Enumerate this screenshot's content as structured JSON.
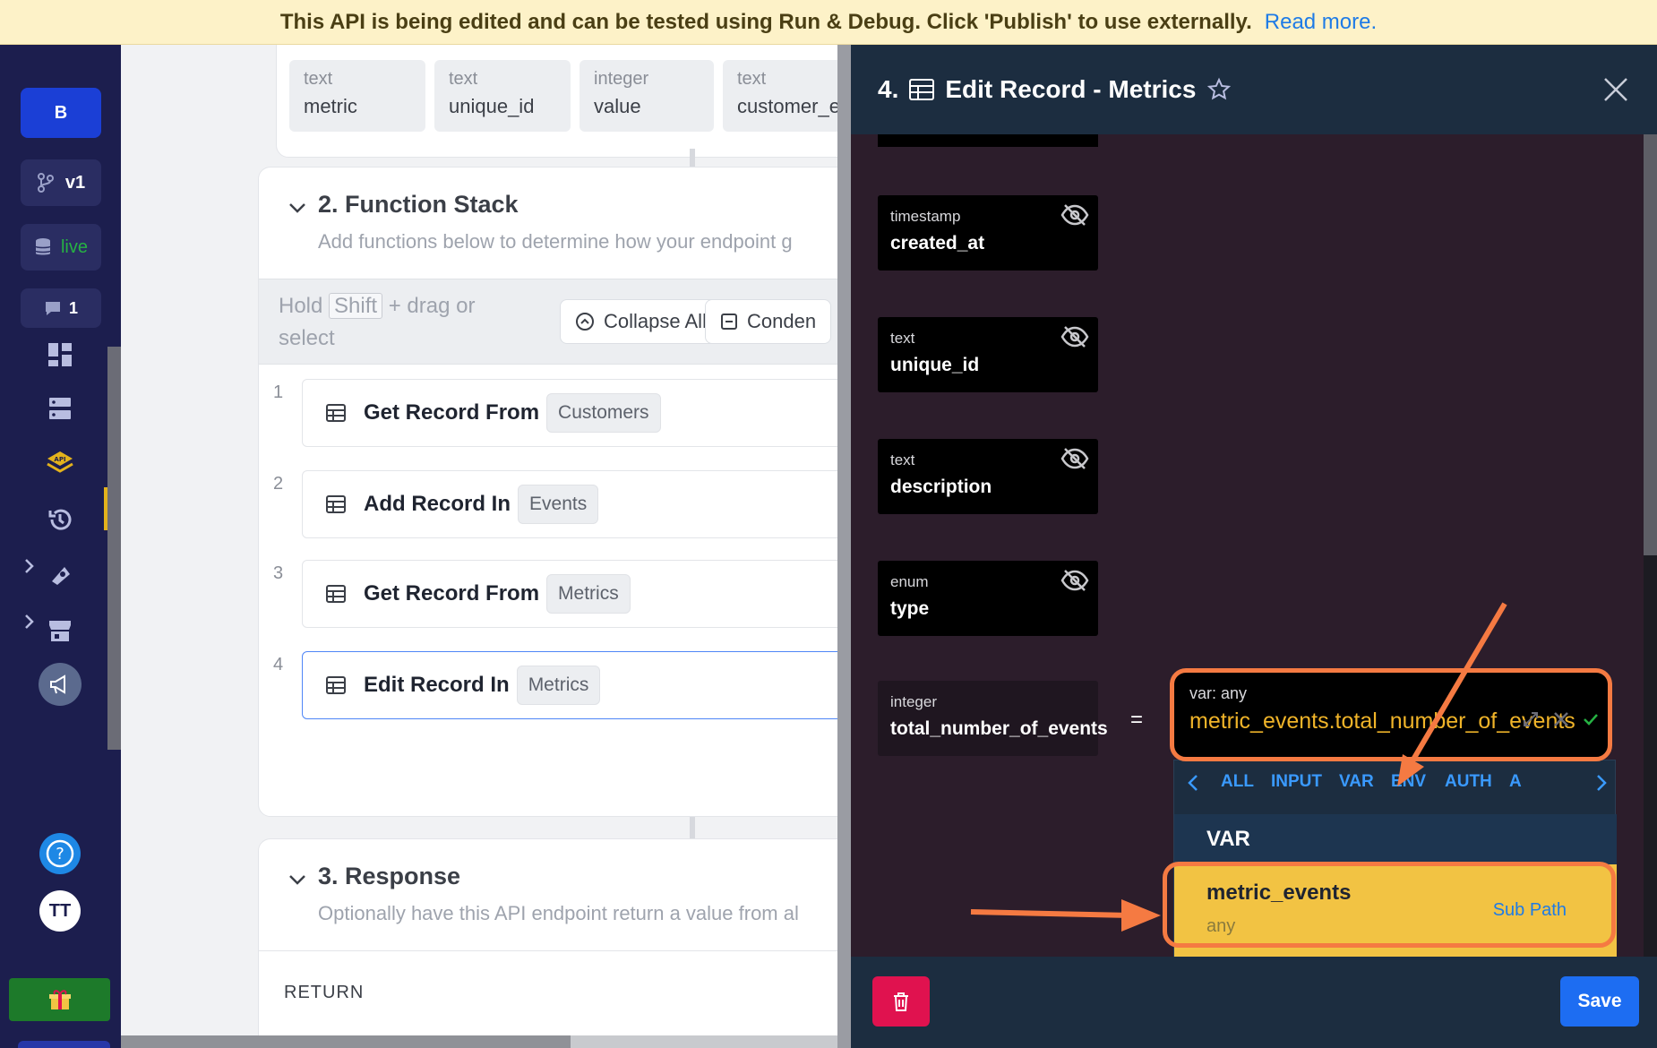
{
  "banner": {
    "message": "This API is being edited and can be tested using Run & Debug. Click 'Publish' to use externally.",
    "link": "Read more."
  },
  "nav": {
    "workspace_initial": "B",
    "branch": "v1",
    "datasource": "live",
    "messages_count": "1",
    "avatar_initials": "TT",
    "icons": [
      "dashboard-icon",
      "database-icon",
      "api-icon",
      "history-icon",
      "addons-icon",
      "marketplace-icon",
      "announcement-icon",
      "help-icon",
      "gift-icon",
      "expand-icon"
    ]
  },
  "inputs": [
    {
      "type": "text",
      "name": "metric"
    },
    {
      "type": "text",
      "name": "unique_id"
    },
    {
      "type": "integer",
      "name": "value"
    },
    {
      "type": "text",
      "name": "customer_e"
    }
  ],
  "function_stack": {
    "title": "2. Function Stack",
    "subtitle": "Add functions below to determine how your endpoint g",
    "hold": "Hold",
    "shift": "Shift",
    "hold_rest": "+ drag or select",
    "collapse_all": "Collapse All",
    "condense": "Conden",
    "steps": [
      {
        "num": "1",
        "label": "Get Record From",
        "table": "Customers"
      },
      {
        "num": "2",
        "label": "Add Record In",
        "table": "Events"
      },
      {
        "num": "3",
        "label": "Get Record From",
        "table": "Metrics"
      },
      {
        "num": "4",
        "label": "Edit Record In",
        "table": "Metrics"
      }
    ]
  },
  "response": {
    "title": "3. Response",
    "subtitle": "Optionally have this API endpoint return a value from al",
    "return_label": "RETURN"
  },
  "panel": {
    "step_num": "4.",
    "title": "Edit Record - Metrics",
    "fields": [
      {
        "type": "timestamp",
        "name": "created_at"
      },
      {
        "type": "text",
        "name": "unique_id"
      },
      {
        "type": "text",
        "name": "description"
      },
      {
        "type": "enum",
        "name": "type"
      }
    ],
    "mapped_field": {
      "type": "integer",
      "name": "total_number_of_events"
    },
    "equals": "=",
    "var_input": {
      "type_label": "var: any",
      "value": "metric_events.total_number_of_events"
    },
    "dropdown": {
      "tabs": [
        "ALL",
        "INPUT",
        "VAR",
        "ENV",
        "AUTH",
        "A"
      ],
      "active_tab": "VAR",
      "section": "VAR",
      "items": [
        {
          "name": "metric_events",
          "type": "any",
          "action": "Sub Path"
        }
      ]
    },
    "save": "Save"
  },
  "colors": {
    "accent": "#1d6df2",
    "highlight": "#f57a42",
    "selected_item": "#f2c343",
    "danger": "#e0124f"
  }
}
